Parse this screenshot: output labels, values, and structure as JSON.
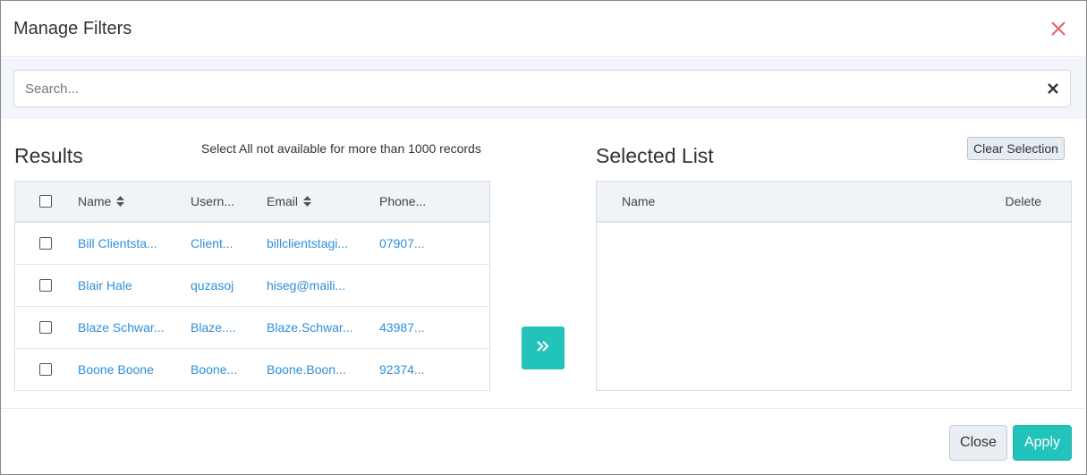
{
  "modal": {
    "title": "Manage Filters",
    "close_icon": "close-icon",
    "accent_color": "#22c3ba",
    "link_color": "#2e8fdb"
  },
  "search": {
    "placeholder": "Search...",
    "value": "",
    "clear_icon": "clear-icon"
  },
  "results": {
    "title": "Results",
    "note": "Select All not available for more than 1000 records",
    "columns": {
      "name": "Name",
      "username": "Usern...",
      "email": "Email",
      "phone": "Phone..."
    },
    "rows": [
      {
        "name": "Bill Clientsta...",
        "username": "Client...",
        "email": "billclientstagi...",
        "phone": "07907..."
      },
      {
        "name": "Blair Hale",
        "username": "quzasoj",
        "email": "hiseg@maili...",
        "phone": ""
      },
      {
        "name": "Blaze Schwar...",
        "username": "Blaze....",
        "email": "Blaze.Schwar...",
        "phone": "43987..."
      },
      {
        "name": "Boone Boone",
        "username": "Boone...",
        "email": "Boone.Boon...",
        "phone": "92374..."
      }
    ]
  },
  "move_button_icon": "double-chevron-right-icon",
  "selected": {
    "title": "Selected List",
    "clear_label": "Clear Selection",
    "columns": {
      "name": "Name",
      "delete": "Delete"
    }
  },
  "footer": {
    "close_label": "Close",
    "apply_label": "Apply"
  }
}
